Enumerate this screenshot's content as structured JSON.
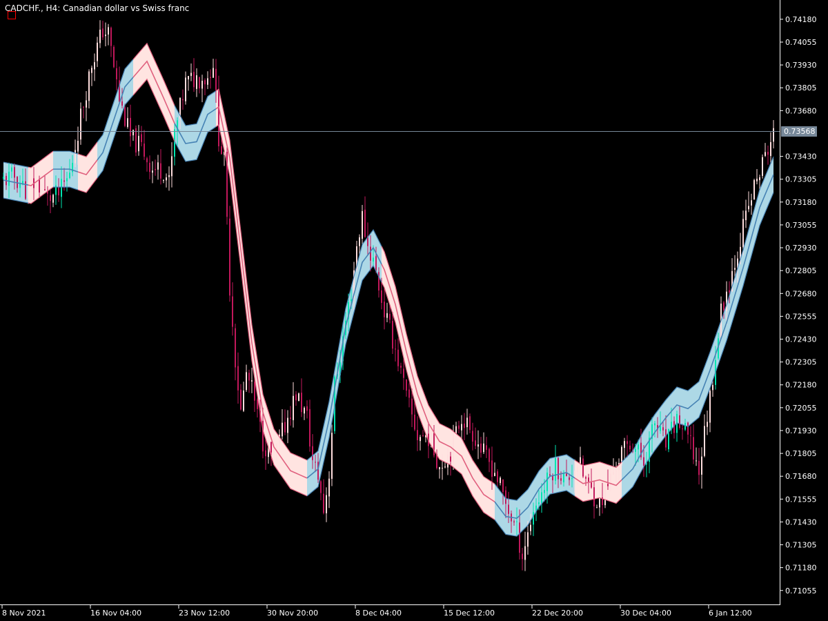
{
  "header": {
    "title": "CADCHF., H4:  Canadian dollar vs Swiss franc"
  },
  "colors": {
    "background": "#000000",
    "axis": "#ffffff",
    "bull_candle": "#ffdede",
    "bear_candle": "#c2185b",
    "bull_candle_alt": "#00e5b0",
    "band_up_fill": "#add8e6",
    "band_down_fill": "#ffe4e1",
    "band_up_line": "#4682b4",
    "band_down_line": "#e0607e",
    "price_line": "#778899",
    "price_label_bg": "#778899",
    "marker": "#ff0000"
  },
  "chart_data": {
    "type": "candlestick",
    "symbol": "CADCHF.",
    "timeframe": "H4",
    "ylim": [
      0.7099,
      0.7424
    ],
    "y_ticks": [
      "0.74180",
      "0.74055",
      "0.73930",
      "0.73805",
      "0.73680",
      "0.73430",
      "0.73305",
      "0.73180",
      "0.73055",
      "0.72930",
      "0.72805",
      "0.72680",
      "0.72555",
      "0.72430",
      "0.72305",
      "0.72180",
      "0.72055",
      "0.71930",
      "0.71805",
      "0.71680",
      "0.71555",
      "0.71430",
      "0.71305",
      "0.71180",
      "0.71055"
    ],
    "current_price": "0.73568",
    "x_ticks": [
      "8 Nov 2021",
      "16 Nov 04:00",
      "23 Nov 12:00",
      "30 Nov 20:00",
      "8 Dec 04:00",
      "15 Dec 12:00",
      "22 Dec 20:00",
      "30 Dec 04:00",
      "6 Jan 12:00"
    ],
    "x_tick_bar_index": [
      0,
      32,
      64,
      96,
      128,
      160,
      192,
      224,
      256
    ],
    "bar_count": 280,
    "price_path_bar": [
      0,
      4,
      8,
      12,
      16,
      20,
      24,
      28,
      32,
      36,
      38,
      42,
      46,
      50,
      54,
      58,
      60,
      62,
      66,
      70,
      74,
      76,
      78,
      80,
      82,
      84,
      86,
      88,
      90,
      94,
      98,
      102,
      106,
      110,
      112,
      114,
      116,
      118,
      120,
      122,
      124,
      126,
      128,
      130,
      132,
      134,
      136,
      138,
      142,
      146,
      150,
      154,
      158,
      162,
      166,
      170,
      174,
      178,
      182,
      186,
      188,
      190,
      192,
      196,
      200,
      204,
      208,
      212,
      216,
      220,
      224,
      228,
      232,
      236,
      240,
      244,
      248,
      252,
      256,
      260,
      264,
      268,
      272,
      276,
      279
    ],
    "price_path_value": [
      0.733,
      0.7332,
      0.7325,
      0.7329,
      0.732,
      0.7322,
      0.7333,
      0.7365,
      0.7394,
      0.7412,
      0.741,
      0.7374,
      0.7353,
      0.7348,
      0.7336,
      0.7336,
      0.7328,
      0.7355,
      0.7383,
      0.7386,
      0.7386,
      0.7395,
      0.7354,
      0.734,
      0.7272,
      0.7232,
      0.7203,
      0.7224,
      0.7215,
      0.7187,
      0.7178,
      0.7196,
      0.7213,
      0.72,
      0.7176,
      0.7168,
      0.7149,
      0.717,
      0.7218,
      0.7234,
      0.7253,
      0.7269,
      0.7294,
      0.731,
      0.7294,
      0.7286,
      0.7272,
      0.7258,
      0.7238,
      0.7211,
      0.719,
      0.719,
      0.7174,
      0.7182,
      0.7201,
      0.7192,
      0.718,
      0.7171,
      0.7153,
      0.7138,
      0.7125,
      0.7137,
      0.715,
      0.7162,
      0.7174,
      0.7165,
      0.7176,
      0.7162,
      0.7153,
      0.7167,
      0.7181,
      0.7186,
      0.7176,
      0.7197,
      0.7185,
      0.7199,
      0.7189,
      0.7171,
      0.7212,
      0.7258,
      0.728,
      0.7304,
      0.7326,
      0.7343,
      0.7356
    ],
    "band_center_bar": [
      0,
      10,
      18,
      24,
      30,
      36,
      44,
      52,
      58,
      62,
      66,
      70,
      74,
      78,
      82,
      86,
      90,
      94,
      98,
      104,
      110,
      114,
      118,
      124,
      130,
      134,
      138,
      142,
      146,
      150,
      154,
      158,
      162,
      166,
      170,
      174,
      178,
      182,
      186,
      190,
      194,
      198,
      204,
      210,
      216,
      222,
      228,
      232,
      236,
      240,
      244,
      248,
      252,
      256,
      262,
      268,
      274,
      279
    ],
    "band_center_value": [
      0.733,
      0.7327,
      0.7336,
      0.7336,
      0.7333,
      0.7345,
      0.7381,
      0.7395,
      0.7375,
      0.7361,
      0.735,
      0.7351,
      0.7366,
      0.737,
      0.7342,
      0.7292,
      0.7241,
      0.7203,
      0.7184,
      0.7171,
      0.7167,
      0.7172,
      0.7199,
      0.725,
      0.7285,
      0.7293,
      0.7281,
      0.7262,
      0.7236,
      0.7213,
      0.7197,
      0.7187,
      0.7184,
      0.7179,
      0.7167,
      0.7158,
      0.7154,
      0.7146,
      0.7145,
      0.7151,
      0.7161,
      0.7168,
      0.717,
      0.7164,
      0.7166,
      0.7163,
      0.7172,
      0.7183,
      0.7192,
      0.72,
      0.7207,
      0.7205,
      0.721,
      0.7226,
      0.7252,
      0.7282,
      0.7315,
      0.7333
    ],
    "band_halfwidth": 0.00098,
    "band_trend_up": [
      [
        0,
        8
      ],
      [
        18,
        26
      ],
      [
        34,
        46
      ],
      [
        62,
        76
      ],
      [
        110,
        136
      ],
      [
        178,
        206
      ],
      [
        224,
        279
      ]
    ]
  }
}
